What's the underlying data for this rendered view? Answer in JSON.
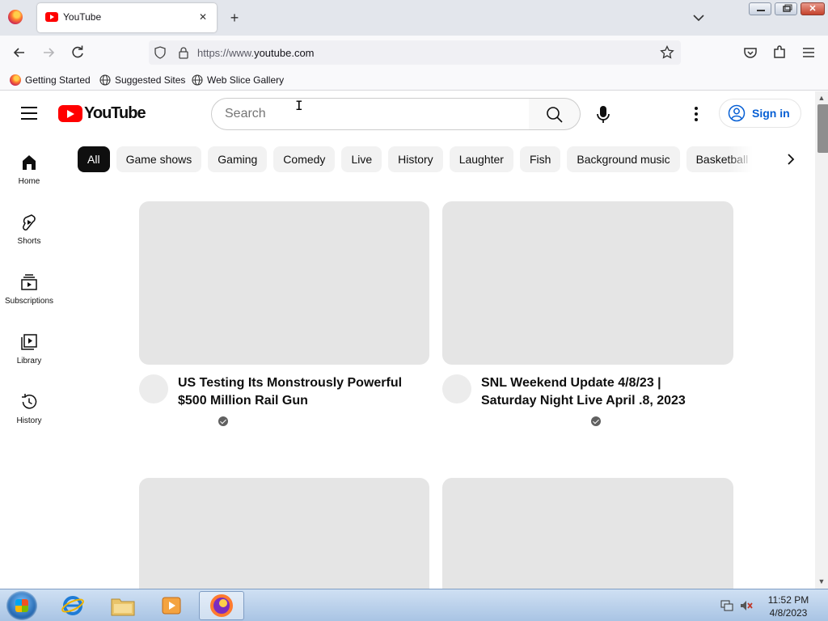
{
  "browser": {
    "tab_title": "YouTube",
    "tab_close": "✕",
    "new_tab": "+",
    "url_prefix": "https://www.",
    "url_domain": "youtube.com",
    "bookmarks": [
      "Getting Started",
      "Suggested Sites",
      "Web Slice Gallery"
    ],
    "window_close": "✕"
  },
  "youtube": {
    "logo_text": "YouTube",
    "search_placeholder": "Search",
    "sign_in": "Sign in",
    "chips": [
      "All",
      "Game shows",
      "Gaming",
      "Comedy",
      "Live",
      "History",
      "Laughter",
      "Fish",
      "Background music",
      "Basketball"
    ],
    "active_chip": "All",
    "sidebar": [
      {
        "label": "Home",
        "icon": "home-icon"
      },
      {
        "label": "Shorts",
        "icon": "shorts-icon"
      },
      {
        "label": "Subscriptions",
        "icon": "subscriptions-icon"
      },
      {
        "label": "Library",
        "icon": "library-icon"
      },
      {
        "label": "History",
        "icon": "history-icon"
      }
    ],
    "videos": [
      {
        "title": "US Testing Its Monstrously Powerful $500 Million Rail Gun",
        "verified": true
      },
      {
        "title": "SNL Weekend Update 4/8/23 | Saturday Night Live April .8, 2023",
        "verified": true
      }
    ]
  },
  "taskbar": {
    "time": "11:52 PM",
    "date": "4/8/2023"
  },
  "colors": {
    "brand_red": "#ff0000",
    "link_blue": "#065fd4",
    "chip_active": "#0f0f0f",
    "placeholder": "#e5e5e5"
  }
}
